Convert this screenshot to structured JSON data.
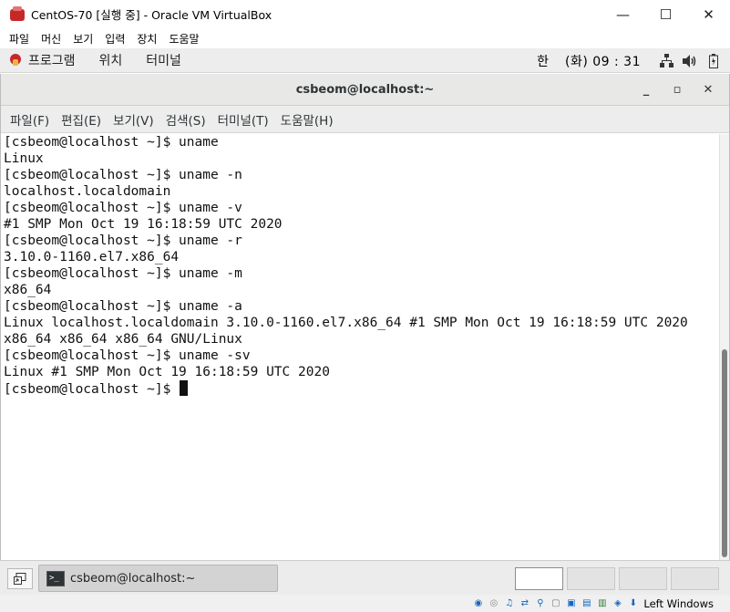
{
  "vbox": {
    "title": "CentOS-70 [실행 중] - Oracle VM VirtualBox",
    "controls": {
      "minimize": "—",
      "maximize": "☐",
      "close": "✕"
    },
    "menu": [
      "파일",
      "머신",
      "보기",
      "입력",
      "장치",
      "도움말"
    ],
    "status": {
      "host_key": "Left Windows"
    }
  },
  "panel": {
    "applications": "프로그램",
    "places": "위치",
    "terminal": "터미널",
    "ime": "한",
    "clock": "(화) 09 : 31"
  },
  "terminal": {
    "title": "csbeom@localhost:~",
    "controls": {
      "minimize": "_",
      "maximize": "▫",
      "close": "✕"
    },
    "menu": [
      "파일(F)",
      "편집(E)",
      "보기(V)",
      "검색(S)",
      "터미널(T)",
      "도움말(H)"
    ],
    "lines": [
      "[csbeom@localhost ~]$ uname",
      "Linux",
      "[csbeom@localhost ~]$ uname -n",
      "localhost.localdomain",
      "[csbeom@localhost ~]$ uname -v",
      "#1 SMP Mon Oct 19 16:18:59 UTC 2020",
      "[csbeom@localhost ~]$ uname -r",
      "3.10.0-1160.el7.x86_64",
      "[csbeom@localhost ~]$ uname -m",
      "x86_64",
      "[csbeom@localhost ~]$ uname -a",
      "Linux localhost.localdomain 3.10.0-1160.el7.x86_64 #1 SMP Mon Oct 19 16:18:59 UTC 2020",
      "x86_64 x86_64 x86_64 GNU/Linux",
      "[csbeom@localhost ~]$ uname -sv",
      "Linux #1 SMP Mon Oct 19 16:18:59 UTC 2020"
    ],
    "prompt": "[csbeom@localhost ~]$ "
  },
  "taskbar": {
    "task_label": "csbeom@localhost:~",
    "workspaces": 4
  }
}
